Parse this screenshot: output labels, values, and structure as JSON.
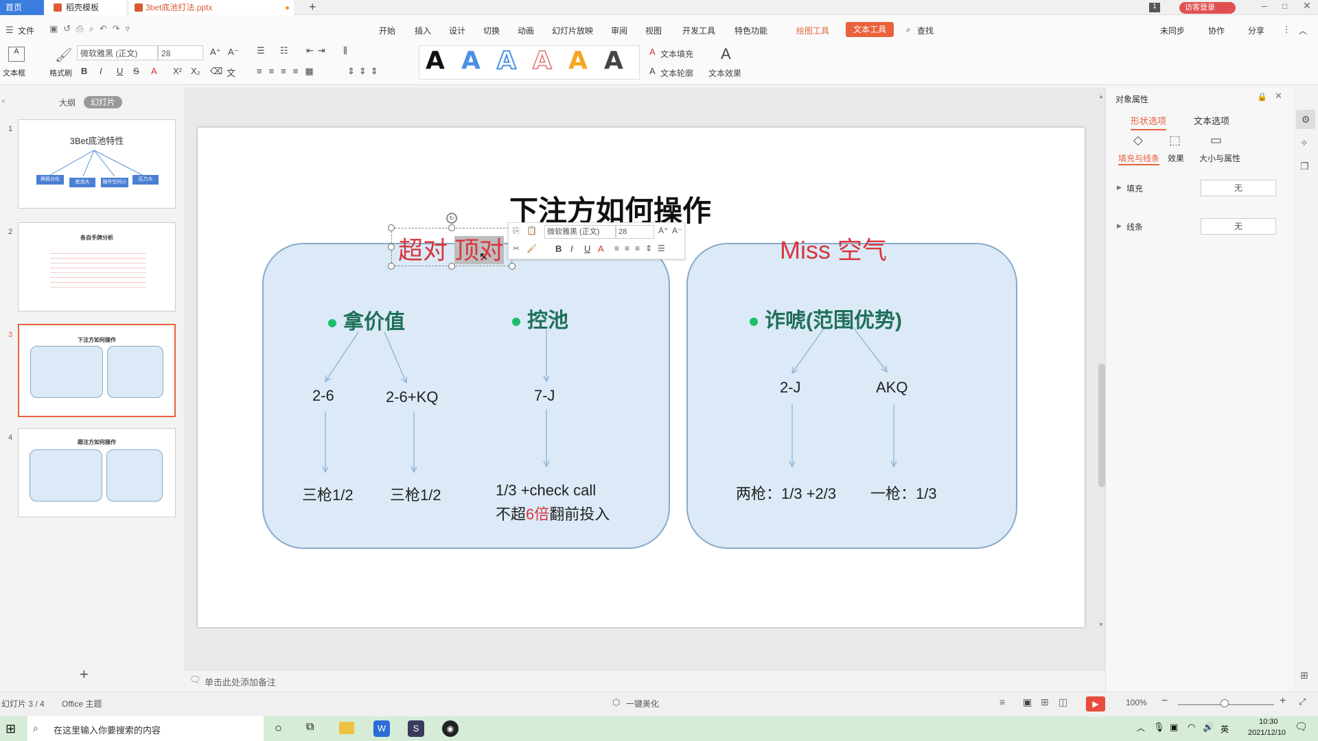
{
  "tabs": {
    "home": "首页",
    "template": "稻壳模板",
    "file": "3bet底池打法.pptx",
    "login": "访客登录"
  },
  "menu": {
    "file": "文件",
    "items": [
      "开始",
      "插入",
      "设计",
      "切换",
      "动画",
      "幻灯片放映",
      "审阅",
      "视图",
      "开发工具",
      "特色功能"
    ],
    "draw_tools": "绘图工具",
    "text_tools": "文本工具",
    "search": "查找",
    "unsync": "未同步",
    "collab": "协作",
    "share": "分享"
  },
  "toolbar": {
    "textbox": "文本框",
    "format_painter": "格式刷",
    "font": "微软雅黑 (正文)",
    "size": "28",
    "text_fill": "文本填充",
    "text_outline": "文本轮廓",
    "text_effect": "文本效果"
  },
  "left": {
    "outline_tab": "大纲",
    "slides_tab": "幻灯片"
  },
  "thumbs": [
    {
      "num": "1",
      "title": "3Bet底池特性",
      "boxes": [
        "两极分化",
        "底池大",
        "操作空间小",
        "压力大"
      ]
    },
    {
      "num": "2",
      "title": "各自手牌分析"
    },
    {
      "num": "3",
      "title": "下注方如何操作"
    },
    {
      "num": "4",
      "title": "跟注方如何操作"
    }
  ],
  "slide": {
    "title": "下注方如何操作",
    "left_heading_a": "超对 ",
    "left_heading_b": "顶对",
    "right_heading": "Miss 空气",
    "bullet1": "拿价值",
    "bullet2": "控池",
    "bullet3": "诈唬(范围优势)",
    "l1": "2-6",
    "l2": "2-6+KQ",
    "l3": "7-J",
    "b1": "三枪1/2",
    "b2": "三枪1/2",
    "b3_line1": "1/3 +check call",
    "b3_pre": "不超",
    "b3_num": "6倍",
    "b3_post": "翻前投入",
    "r1": "2-J",
    "r2": "AKQ",
    "rb1": "两枪：1/3 +2/3",
    "rb2": "一枪：1/3"
  },
  "floatbar": {
    "font": "微软雅黑 (正文)",
    "size": "28"
  },
  "right": {
    "title": "对象属性",
    "tab1": "形状选项",
    "tab2": "文本选项",
    "sub1": "填充与线条",
    "sub2": "效果",
    "sub3": "大小与属性",
    "fill": "填充",
    "line": "线条",
    "none1": "无",
    "none2": "无"
  },
  "notes": {
    "placeholder": "单击此处添加备注"
  },
  "status": {
    "slide": "幻灯片 3 / 4",
    "theme": "Office 主题",
    "beautify": "一键美化",
    "zoom": "100%"
  },
  "taskbar": {
    "search": "在这里输入你要搜索的内容",
    "time": "10:30",
    "date": "2021/12/10",
    "lang": "英"
  },
  "colors": {
    "accent": "#e8623c",
    "red_text": "#d9363e",
    "green_head": "#1f6f5a",
    "panel_bg": "#dbeaf6",
    "arrow": "#8fb3d9"
  }
}
